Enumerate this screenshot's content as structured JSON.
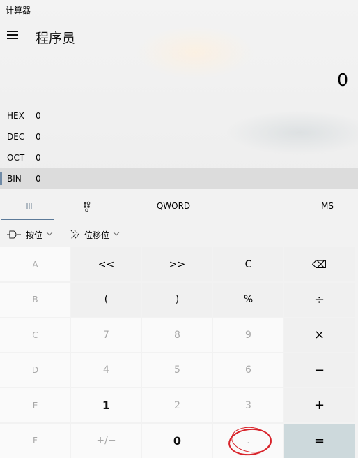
{
  "app": {
    "title": "计算器",
    "mode": "程序员"
  },
  "display": {
    "value": "0"
  },
  "radix": [
    {
      "label": "HEX",
      "value": "0"
    },
    {
      "label": "DEC",
      "value": "0"
    },
    {
      "label": "OCT",
      "value": "0"
    },
    {
      "label": "BIN",
      "value": "0",
      "active": true
    }
  ],
  "tabs": {
    "keypad_icon": "full-keypad-icon",
    "bits_icon": "bit-toggle-keypad-icon",
    "word_size": "QWORD",
    "memory_store": "MS"
  },
  "operators": {
    "bitwise_label": "按位",
    "bitwise_icon": "logic-gate-icon",
    "shift_label": "位移位",
    "shift_icon": "bit-shift-icon"
  },
  "keys": [
    [
      "A",
      "<<",
      ">>",
      "C",
      "⌫"
    ],
    [
      "B",
      "(",
      ")",
      "%",
      "÷"
    ],
    [
      "C",
      "7",
      "8",
      "9",
      "×"
    ],
    [
      "D",
      "4",
      "5",
      "6",
      "−"
    ],
    [
      "E",
      "1",
      "2",
      "3",
      "+"
    ],
    [
      "F",
      "+/−",
      "0",
      ".",
      "="
    ]
  ],
  "annotation_color": "#d8232a"
}
